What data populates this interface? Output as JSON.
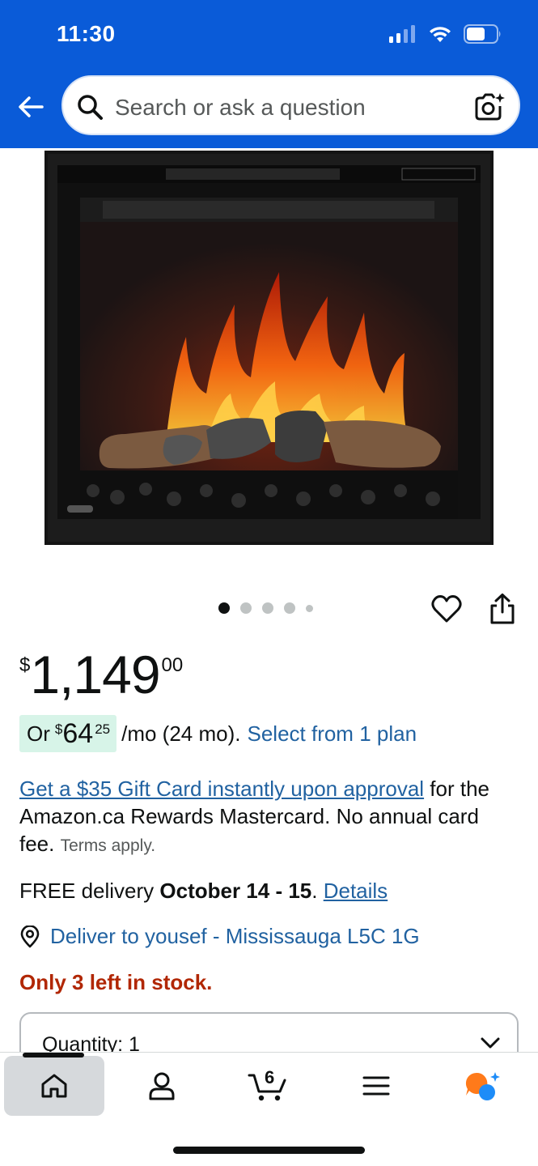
{
  "status_bar": {
    "time": "11:30"
  },
  "search": {
    "placeholder": "Search or ask a question"
  },
  "product": {
    "image_alt": "Electric fireplace insert",
    "image_dots_count": 5,
    "image_active_index": 0
  },
  "price": {
    "symbol": "$",
    "whole": "1,149",
    "fraction": "00"
  },
  "monthly": {
    "prefix": "Or",
    "symbol": "$",
    "whole": "64",
    "fraction": "25",
    "suffix": "/mo (24 mo).",
    "link": "Select from 1 plan"
  },
  "promo": {
    "link": "Get a $35 Gift Card instantly upon approval",
    "text": " for the Amazon.ca Rewards Mastercard. No annual card fee.",
    "terms": "Terms apply."
  },
  "delivery": {
    "prefix": "FREE delivery ",
    "dates": "October 14 - 15",
    "dot": ". ",
    "link": "Details"
  },
  "deliver_to": {
    "text": "Deliver to yousef - Mississauga L5C 1G"
  },
  "stock": {
    "text": "Only 3 left in stock."
  },
  "quantity": {
    "label": "Quantity: 1"
  },
  "bottom_nav": {
    "cart_count": "6"
  },
  "colors": {
    "header_blue": "#0a5bd8",
    "link_blue": "#2162a1",
    "stock_red": "#b12704",
    "badge_green": "#d7f4e8",
    "rufus_orange": "#ff7a1a",
    "rufus_blue": "#1d8cf8"
  },
  "icons": [
    "back-arrow-icon",
    "search-icon",
    "camera-icon",
    "heart-icon",
    "share-icon",
    "location-pin-icon",
    "chevron-down-icon",
    "home-icon",
    "account-icon",
    "cart-icon",
    "menu-icon",
    "rufus-icon"
  ]
}
